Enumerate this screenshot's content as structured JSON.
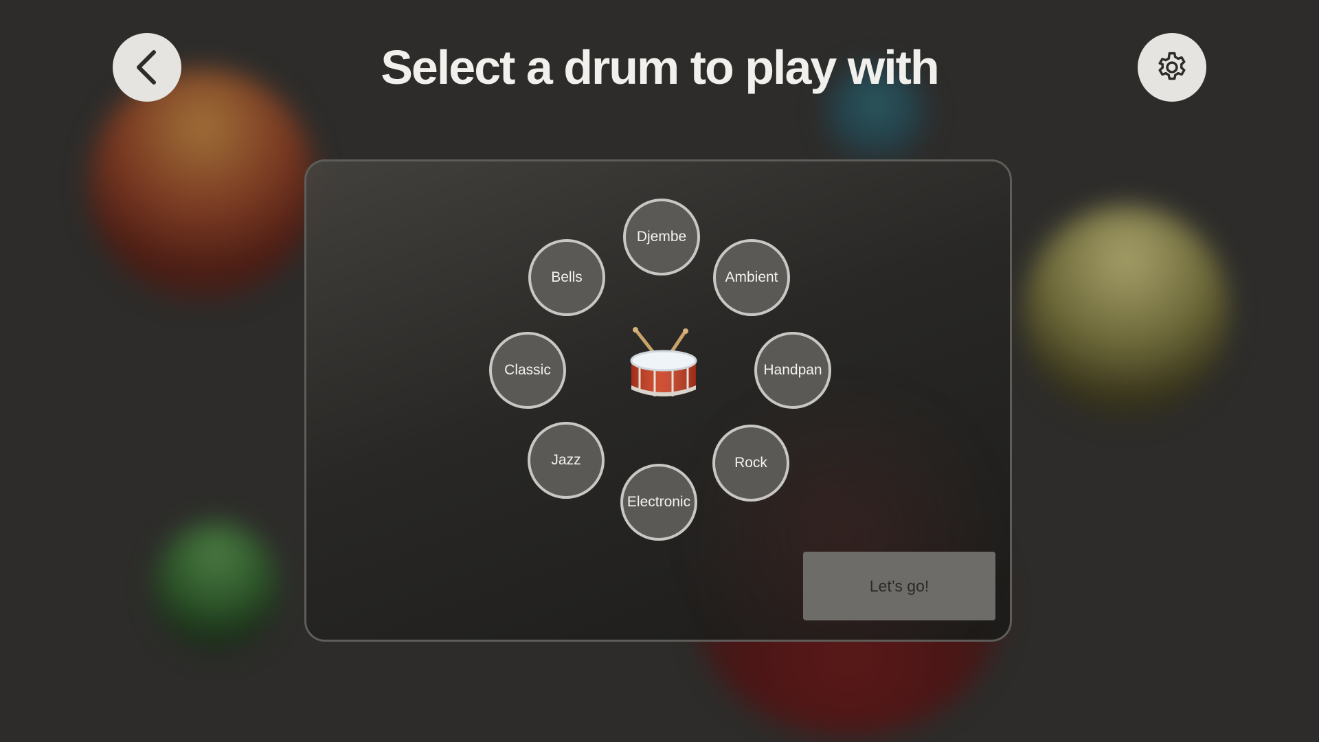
{
  "header": {
    "title": "Select a drum to play with",
    "back_icon": "chevron-left-icon",
    "settings_icon": "gear-icon"
  },
  "drums": {
    "center_icon": "drum-icon",
    "options": [
      {
        "id": "djembe",
        "label": "Djembe"
      },
      {
        "id": "ambient",
        "label": "Ambient"
      },
      {
        "id": "handpan",
        "label": "Handpan"
      },
      {
        "id": "rock",
        "label": "Rock"
      },
      {
        "id": "electronic",
        "label": "Electronic"
      },
      {
        "id": "jazz",
        "label": "Jazz"
      },
      {
        "id": "classic",
        "label": "Classic"
      },
      {
        "id": "bells",
        "label": "Bells"
      }
    ]
  },
  "actions": {
    "go_label": "Let’s go!"
  },
  "colors": {
    "background": "#2d2c2a",
    "button_light": "#e6e4e0",
    "drum_button_fill": "#5a5955",
    "drum_button_border": "#c9c7c3",
    "go_button": "#6d6c68"
  }
}
